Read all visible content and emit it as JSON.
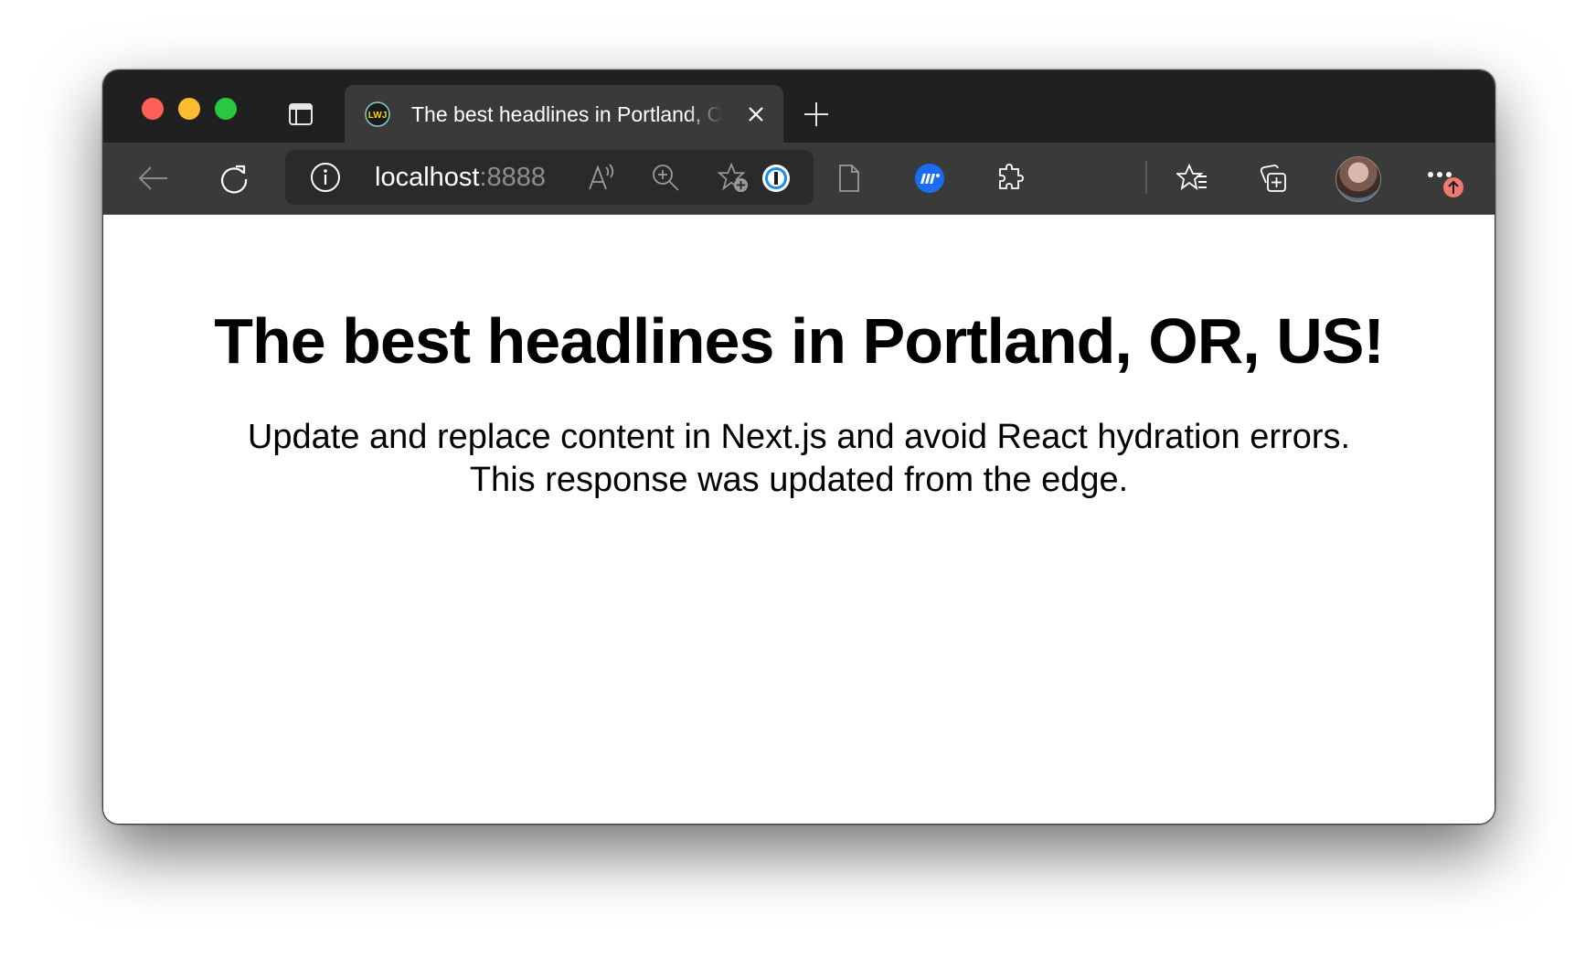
{
  "browser": {
    "window_controls": [
      "close",
      "minimize",
      "maximize"
    ],
    "tab": {
      "favicon_text": "LWJ",
      "title": "The best headlines in Portland, OR, US!",
      "close_icon": "close-icon"
    },
    "new_tab_icon": "plus-icon",
    "address_bar": {
      "host": "localhost",
      "port": ":8888",
      "site_info_icon": "info-icon"
    },
    "address_actions": [
      "read-aloud-icon",
      "zoom-in-icon",
      "add-favorite-icon"
    ],
    "extensions": [
      "1password-icon",
      "document-icon",
      "blue-extension-icon",
      "extensions-puzzle-icon"
    ],
    "toolbar_actions": [
      "favorites-icon",
      "collections-icon",
      "profile-avatar",
      "more-menu-icon"
    ],
    "update_badge": "update-available"
  },
  "page": {
    "headline": "The best headlines in Portland, OR, US!",
    "subtext_line1": "Update and replace content in Next.js and avoid React hydration errors.",
    "subtext_line2": "This response was updated from the edge."
  },
  "colors": {
    "titlebar": "#202020",
    "toolbar": "#3a3a3a",
    "address_bar": "#2a2a2a",
    "traffic_close": "#ff5f57",
    "traffic_min": "#febc2e",
    "traffic_max": "#28c840",
    "extension_blue": "#1a6cf0",
    "badge": "#f07a72"
  }
}
